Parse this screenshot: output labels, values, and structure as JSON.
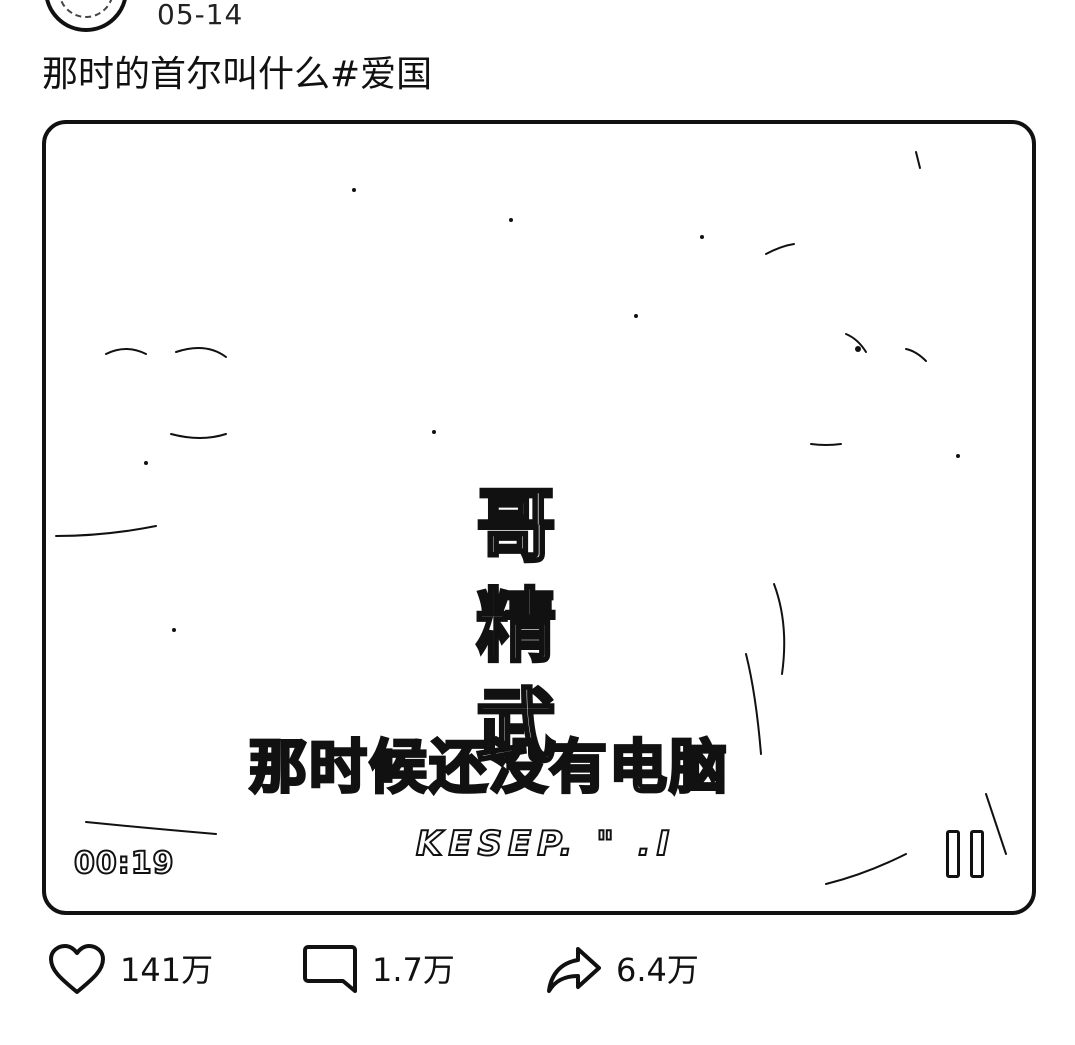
{
  "post": {
    "date": "05-14",
    "caption": "那时的首尔叫什么#爱国"
  },
  "video": {
    "center_chars": [
      "哥",
      "精",
      "武"
    ],
    "subtitle": "那时候还没有电脑",
    "watermark": "KESEP. \" .I",
    "timestamp": "00:19",
    "state": "playing"
  },
  "actions": {
    "like_count": "141万",
    "comment_count": "1.7万",
    "share_count": "6.4万"
  },
  "icons": {
    "like": "heart-outline-icon",
    "comment": "comment-bubble-icon",
    "share": "share-arrow-icon",
    "pause": "pause-icon"
  }
}
